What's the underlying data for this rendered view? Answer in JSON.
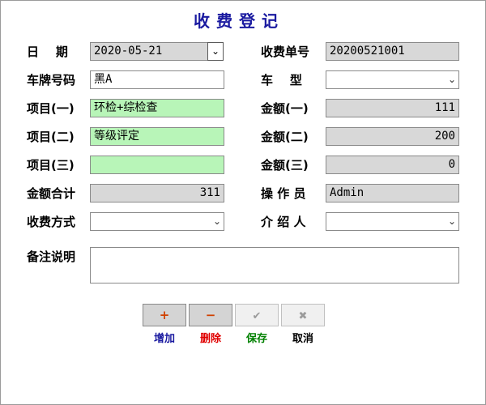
{
  "title": "收费登记",
  "left": {
    "date": {
      "label": "日    期",
      "value": "2020-05-21"
    },
    "plate": {
      "label": "车牌号码",
      "value": "黑A"
    },
    "item1": {
      "label": "项目(一)",
      "value": "环检+综检查"
    },
    "item2": {
      "label": "项目(二)",
      "value": "等级评定"
    },
    "item3": {
      "label": "项目(三)",
      "value": ""
    },
    "total": {
      "label": "金额合计",
      "value": "311"
    },
    "pay_method": {
      "label": "收费方式",
      "value": ""
    }
  },
  "right": {
    "receipt": {
      "label": "收费单号",
      "value": "20200521001"
    },
    "vehicle_type": {
      "label": "车    型",
      "value": ""
    },
    "amount1": {
      "label": "金额(一)",
      "value": "111"
    },
    "amount2": {
      "label": "金额(二)",
      "value": "200"
    },
    "amount3": {
      "label": "金额(三)",
      "value": "0"
    },
    "operator": {
      "label": "操 作 员",
      "value": "Admin"
    },
    "referrer": {
      "label": "介 绍 人",
      "value": ""
    }
  },
  "remarks": {
    "label": "备注说明",
    "value": ""
  },
  "buttons": {
    "add": {
      "icon": "+",
      "label": "增加",
      "color": "#1a1aa0",
      "icon_color": "#d04000"
    },
    "delete": {
      "icon": "−",
      "label": "删除",
      "color": "#e00000",
      "icon_color": "#d04000"
    },
    "save": {
      "icon": "✔",
      "label": "保存",
      "color": "#008000",
      "icon_color": "#9a9a9a"
    },
    "cancel": {
      "icon": "✖",
      "label": "取消",
      "color": "#000000",
      "icon_color": "#9a9a9a"
    }
  }
}
